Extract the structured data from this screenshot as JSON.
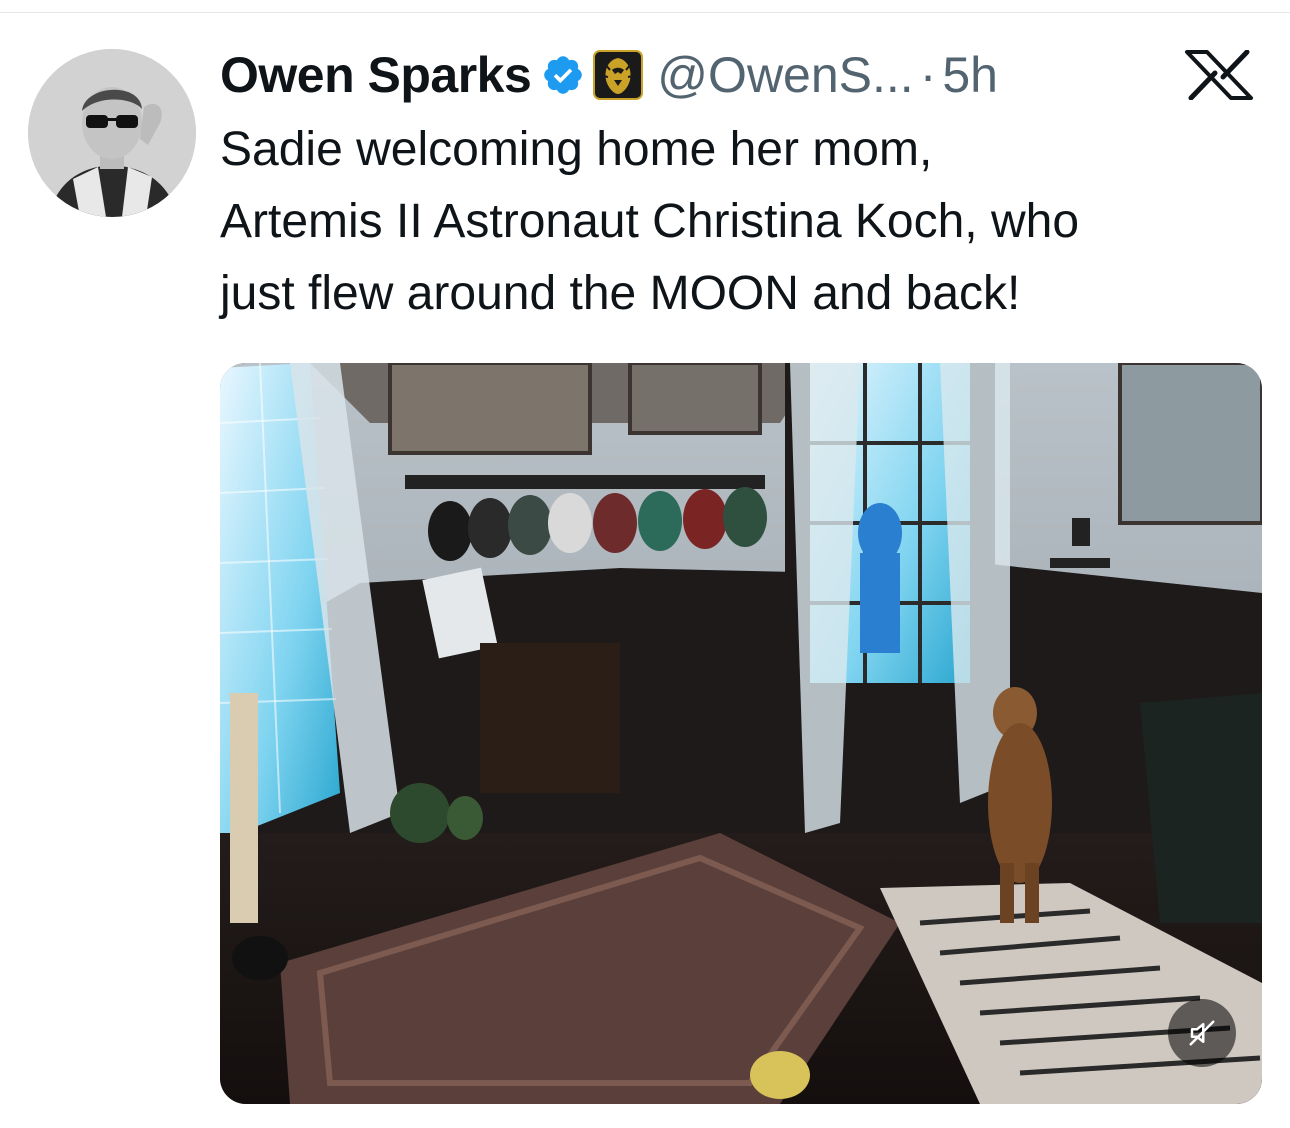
{
  "tweet": {
    "author": {
      "display_name": "Owen Sparks",
      "handle": "@OwenS...",
      "avatar": "profile-photo-man-in-sunglasses",
      "verified": true,
      "verified_icon": "verified-badge-icon",
      "affiliate_icon": "lion-head-affiliate-badge-icon"
    },
    "separator": "·",
    "timestamp": "5h",
    "text": "Sadie welcoming home her mom,\nArtemis II Astronaut Christina Koch, who\njust flew around the MOON and back!",
    "media": {
      "type": "video",
      "description_icon": "video-thumbnail",
      "mute_icon": "speaker-muted-icon"
    }
  },
  "brand": {
    "logo_icon": "x-logo-icon"
  },
  "colors": {
    "text_primary": "#0f1419",
    "text_secondary": "#536471",
    "verified_blue": "#1d9bf0",
    "affiliate_gold": "#c9a227"
  }
}
